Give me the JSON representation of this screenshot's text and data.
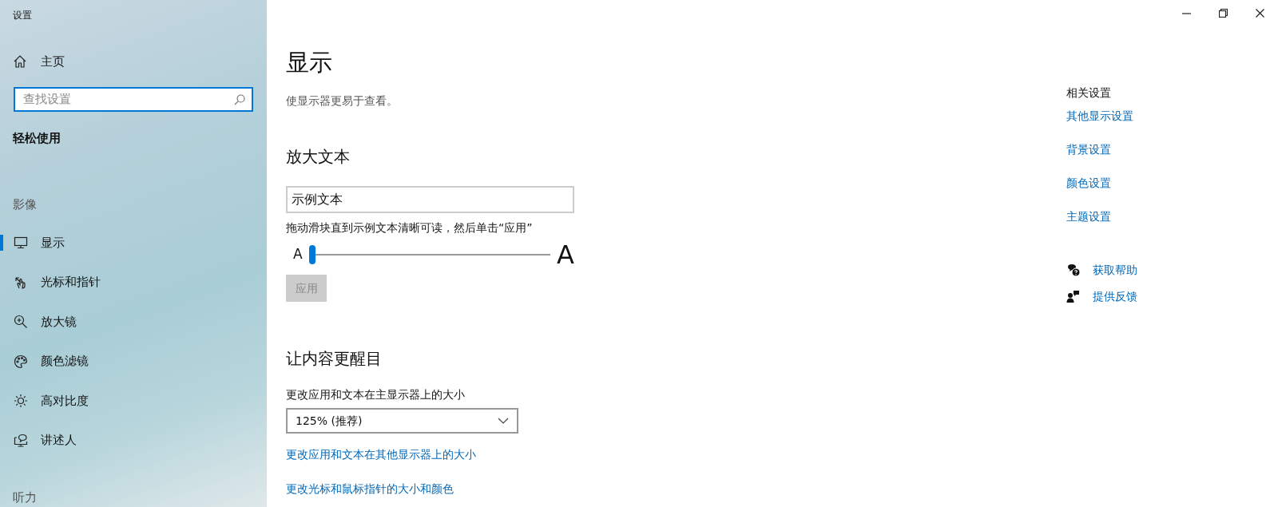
{
  "window": {
    "title": "设置"
  },
  "sidebar": {
    "home": "主页",
    "search": {
      "placeholder": "查找设置",
      "focused": true
    },
    "category": "轻松使用",
    "groups": [
      {
        "label": "影像",
        "items": [
          {
            "label": "显示",
            "selected": true
          },
          {
            "label": "光标和指针",
            "selected": false
          },
          {
            "label": "放大镜",
            "selected": false
          },
          {
            "label": "颜色滤镜",
            "selected": false
          },
          {
            "label": "高对比度",
            "selected": false
          },
          {
            "label": "讲述人",
            "selected": false
          }
        ]
      },
      {
        "label": "听力"
      }
    ]
  },
  "page": {
    "title": "显示",
    "subtitle": "使显示器更易于查看。",
    "sections": [
      {
        "kind": "text_size",
        "heading": "放大文本",
        "sample": "示例文本",
        "instruction": "拖动滑块直到示例文本清晰可读，然后单击“应用”",
        "small_glyph": "A",
        "large_glyph": "A",
        "slider": {
          "level": 0
        },
        "apply": {
          "label": "应用",
          "disabled": true
        }
      },
      {
        "kind": "scale",
        "heading": "让内容更醒目",
        "label": "更改应用和文本在主显示器上的大小",
        "dropdown": {
          "value": "125% (推荐)"
        },
        "links": [
          "更改应用和文本在其他显示器上的大小",
          "更改光标和鼠标指针的大小和颜色"
        ]
      }
    ]
  },
  "related": {
    "heading": "相关设置",
    "links": [
      "其他显示设置",
      "背景设置",
      "颜色设置",
      "主题设置"
    ],
    "help": [
      {
        "label": "获取帮助"
      },
      {
        "label": "提供反馈"
      }
    ]
  }
}
